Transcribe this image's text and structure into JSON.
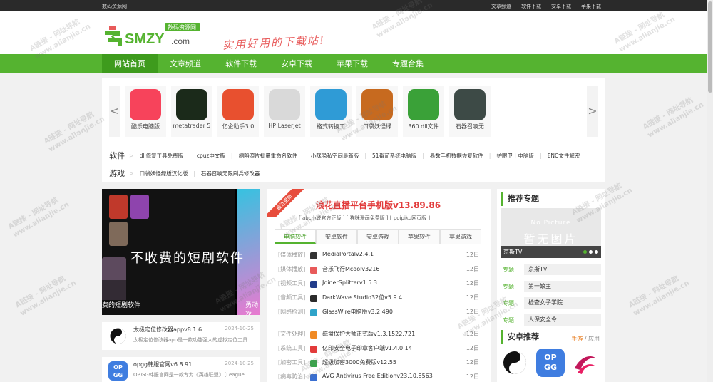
{
  "topbar": {
    "site_name": "数码资源网",
    "links": [
      "文章频道",
      "软件下载",
      "安卓下载",
      "苹果下载"
    ]
  },
  "header": {
    "logo_text": "SMZY",
    "logo_badge": "数码资源网",
    "logo_suffix": ".com",
    "slogan": "实用好用的下载站!"
  },
  "nav": {
    "items": [
      "网站首页",
      "文章频道",
      "软件下载",
      "安卓下载",
      "苹果下载",
      "专题合集"
    ],
    "active": "网站首页"
  },
  "apps": [
    {
      "name": "酷乐电脑版",
      "color": "#f7435b"
    },
    {
      "name": "metatrader 5",
      "color": "#1b2a1a"
    },
    {
      "name": "亿企助手3.0",
      "color": "#e8502f"
    },
    {
      "name": "HP LaserJet",
      "color": "#d9d9d9"
    },
    {
      "name": "格式转换工",
      "color": "#2f9bd6"
    },
    {
      "name": "口袋妖怪绿",
      "color": "#c76a1f"
    },
    {
      "name": "360 dll文件",
      "color": "#3aa138"
    },
    {
      "name": "石器召唤无",
      "color": "#3d4a46"
    }
  ],
  "tags": {
    "software_label": "软件",
    "software": [
      "dll修复工具免费版",
      "cpuz中文版",
      "缩略照片批量重命名软件",
      "小咪隐私空间最新版",
      "51番茄系统电脑版",
      "易数手机数据恢复软件",
      "护眼卫士电脑版",
      "ENC文件解密"
    ],
    "game_label": "游戏",
    "games": [
      "口袋妖怪绿版汉化版",
      "石器召唤无限刷兵修改器"
    ]
  },
  "banner": {
    "headline": "不收费的短剧软件",
    "caption": "费的短剧软件",
    "caption2": "勇动次"
  },
  "left_list": [
    {
      "title": "太极定位修改器appv8.1.6",
      "date": "2024-10-25",
      "desc": "太极定位修改器app是一款功能强大的虚拟定位工具...",
      "color": "#111111"
    },
    {
      "title": "opgg韩服官网v6.8.91",
      "date": "2024-10-25",
      "desc": "OP.GG韩服官网是一款专为《英雄联盟》（League...",
      "color": "#3f7de0"
    }
  ],
  "featured": {
    "ribbon": "最近更新",
    "headline": "浪花直播平台手机版v13.89.86",
    "sublinks": [
      "abc小说官方正版",
      "猫咪漫画免费版",
      "poipiku网页版"
    ]
  },
  "tabs": [
    "电脑软件",
    "安卓软件",
    "安卓游戏",
    "苹果软件",
    "苹果游戏"
  ],
  "active_tab": "电脑软件",
  "software_list": [
    {
      "cat": "[媒体播放]",
      "name": "MediaPortalv2.4.1",
      "date": "12日",
      "color": "#333333"
    },
    {
      "cat": "[媒体播放]",
      "name": "音乐飞行Mcoolv3216",
      "date": "12日",
      "color": "#e85a5a"
    },
    {
      "cat": "[视频工具]",
      "name": "JoinerSplitterv1.5.3",
      "date": "12日",
      "color": "#223c8a"
    },
    {
      "cat": "[音频工具]",
      "name": "DarkWave Studio32位v5.9.4",
      "date": "12日",
      "color": "#2b2b2b"
    },
    {
      "cat": "[网络检测]",
      "name": "GlassWire电脑版v3.2.490",
      "date": "12日",
      "color": "#2fa3c9"
    },
    {
      "cat": "[文件处理]",
      "name": "磁盘保护大师正式版v1.3.1522.721",
      "date": "12日",
      "color": "#f08a24"
    },
    {
      "cat": "[系统工具]",
      "name": "亿印安全电子印章客户端v1.4.0.14",
      "date": "12日",
      "color": "#e23b3b"
    },
    {
      "cat": "[加密工具]",
      "name": "超级加密3000免费版v12.55",
      "date": "12日",
      "color": "#38a74a"
    },
    {
      "cat": "[病毒防治]",
      "name": "AVG Antivirus Free Editionv23.10.8563",
      "date": "12日",
      "color": "#3a6fd1"
    }
  ],
  "right": {
    "topics_title": "推荐专题",
    "nopic_en": "No Picture",
    "nopic_cn": "暂无图片",
    "pic_caption": "京斯TV",
    "topic_label": "专题",
    "topics": [
      "京斯TV",
      "第一娘主",
      "检查女子学院",
      "人保安全令"
    ],
    "android_title": "安卓推荐",
    "more_games": "手游",
    "more_apps": "应用",
    "android_icons": [
      {
        "name": "taiji-icon",
        "color": "#ffffff"
      },
      {
        "name": "opgg-icon",
        "color": "#3f7de0"
      },
      {
        "name": "pink-app-icon",
        "color": "#ffffff"
      }
    ]
  },
  "watermark": "A链接 - 网址导航"
}
